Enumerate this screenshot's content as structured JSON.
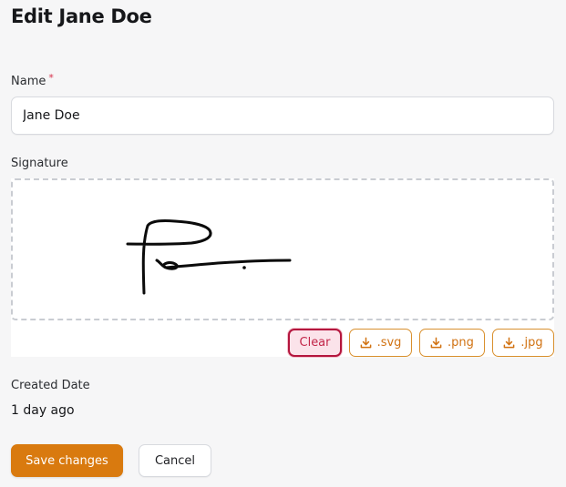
{
  "page": {
    "title": "Edit Jane Doe"
  },
  "name_field": {
    "label": "Name",
    "required_mark": "*",
    "value": "Jane Doe"
  },
  "signature_field": {
    "label": "Signature",
    "buttons": {
      "clear": "Clear",
      "svg": ".svg",
      "png": ".png",
      "jpg": ".jpg"
    },
    "icons": {
      "download": "download-icon"
    }
  },
  "created_date": {
    "label": "Created Date",
    "value": "1 day ago"
  },
  "actions": {
    "save": "Save changes",
    "cancel": "Cancel"
  },
  "colors": {
    "primary": "#d97a0f",
    "danger": "#b4153d",
    "download_accent": "#d17212"
  }
}
